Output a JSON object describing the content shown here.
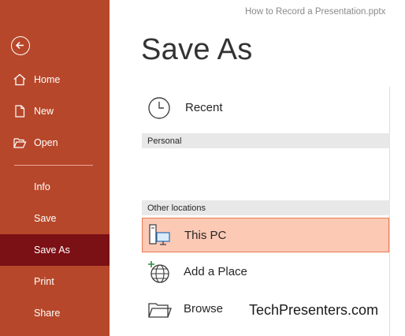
{
  "window": {
    "document_title": "How to Record a Presentation.pptx"
  },
  "sidebar": {
    "back": {
      "icon": "back-arrow-icon"
    },
    "items": [
      {
        "label": "Home",
        "icon": "home-icon"
      },
      {
        "label": "New",
        "icon": "new-document-icon"
      },
      {
        "label": "Open",
        "icon": "open-folder-icon"
      },
      {
        "label": "Info"
      },
      {
        "label": "Save"
      },
      {
        "label": "Save As",
        "selected": true
      },
      {
        "label": "Print"
      },
      {
        "label": "Share"
      }
    ]
  },
  "main": {
    "title": "Save As",
    "recent": {
      "label": "Recent",
      "icon": "clock-icon"
    },
    "sections": {
      "personal": "Personal",
      "other_locations": "Other locations"
    },
    "locations": [
      {
        "label": "This PC",
        "icon": "this-pc-icon",
        "selected": true
      },
      {
        "label": "Add a Place",
        "icon": "add-place-globe-icon"
      },
      {
        "label": "Browse",
        "icon": "browse-folder-icon"
      }
    ]
  },
  "watermark": "TechPresenters.com",
  "colors": {
    "sidebar_bg": "#b7472a",
    "sidebar_selected": "#7b1015",
    "location_selected_bg": "#fcc9b5",
    "location_selected_border": "#e77a55"
  }
}
